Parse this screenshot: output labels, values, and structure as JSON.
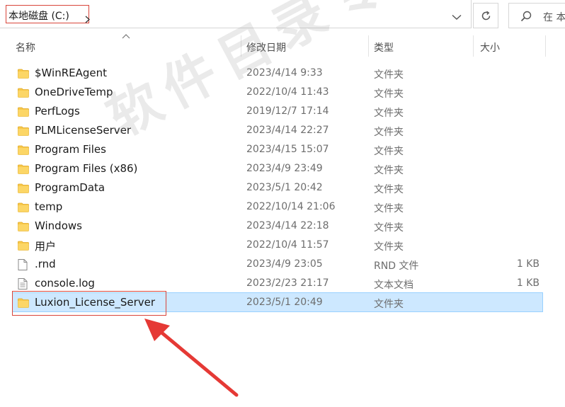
{
  "address": {
    "path_label": "本地磁盘 (C:)"
  },
  "search": {
    "placeholder": "在 本"
  },
  "columns": {
    "name": "名称",
    "date": "修改日期",
    "type": "类型",
    "size": "大小"
  },
  "rows": [
    {
      "name": "$WinREAgent",
      "date": "2023/4/14 9:33",
      "type": "文件夹",
      "size": "",
      "icon": "folder-icon"
    },
    {
      "name": "OneDriveTemp",
      "date": "2022/10/4 11:43",
      "type": "文件夹",
      "size": "",
      "icon": "folder-icon"
    },
    {
      "name": "PerfLogs",
      "date": "2019/12/7 17:14",
      "type": "文件夹",
      "size": "",
      "icon": "folder-icon"
    },
    {
      "name": "PLMLicenseServer",
      "date": "2023/4/14 22:27",
      "type": "文件夹",
      "size": "",
      "icon": "folder-icon"
    },
    {
      "name": "Program Files",
      "date": "2023/4/15 15:07",
      "type": "文件夹",
      "size": "",
      "icon": "folder-icon"
    },
    {
      "name": "Program Files (x86)",
      "date": "2023/4/9 23:49",
      "type": "文件夹",
      "size": "",
      "icon": "folder-icon"
    },
    {
      "name": "ProgramData",
      "date": "2023/5/1 20:42",
      "type": "文件夹",
      "size": "",
      "icon": "folder-icon"
    },
    {
      "name": "temp",
      "date": "2022/10/14 21:06",
      "type": "文件夹",
      "size": "",
      "icon": "folder-icon"
    },
    {
      "name": "Windows",
      "date": "2023/4/14 22:18",
      "type": "文件夹",
      "size": "",
      "icon": "folder-icon"
    },
    {
      "name": "用户",
      "date": "2022/10/4 11:57",
      "type": "文件夹",
      "size": "",
      "icon": "folder-icon"
    },
    {
      "name": ".rnd",
      "date": "2023/4/9 23:05",
      "type": "RND 文件",
      "size": "1 KB",
      "icon": "file-icon"
    },
    {
      "name": "console.log",
      "date": "2023/2/23 21:17",
      "type": "文本文档",
      "size": "1 KB",
      "icon": "text-file-icon"
    },
    {
      "name": "Luxion_License_Server",
      "date": "2023/5/1 20:49",
      "type": "文件夹",
      "size": "",
      "icon": "folder-icon"
    }
  ],
  "selected_row": "Luxion_License_Server",
  "watermark": "软件目录专用",
  "colors": {
    "selection": "#cde8ff",
    "highlight_box": "#d9453a",
    "folder": "#f8c84a"
  }
}
